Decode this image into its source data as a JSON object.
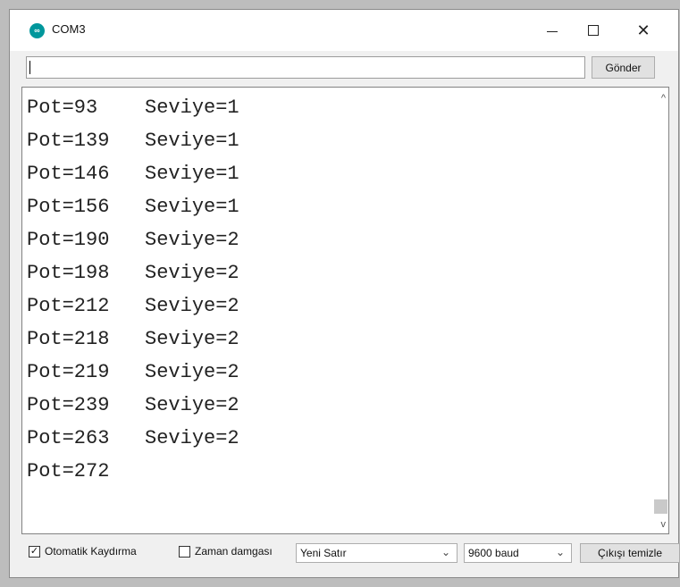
{
  "window": {
    "title": "COM3",
    "icon": "arduino-icon",
    "controls": {
      "minimize": "–",
      "maximize": "□",
      "close": "✕"
    }
  },
  "input_bar": {
    "value": "",
    "send_label": "Gönder"
  },
  "output": {
    "lines": [
      "Pot=93    Seviye=1",
      "Pot=139   Seviye=1",
      "Pot=146   Seviye=1",
      "Pot=156   Seviye=1",
      "Pot=190   Seviye=2",
      "Pot=198   Seviye=2",
      "Pot=212   Seviye=2",
      "Pot=218   Seviye=2",
      "Pot=219   Seviye=2",
      "Pot=239   Seviye=2",
      "Pot=263   Seviye=2",
      "Pot=272"
    ]
  },
  "bottom": {
    "autoscroll": {
      "label": "Otomatik Kaydırma",
      "checked": true,
      "mark": "✓"
    },
    "timestamp": {
      "label": "Zaman damgası",
      "checked": false,
      "mark": ""
    },
    "line_ending": {
      "value": "Yeni Satır"
    },
    "baud": {
      "value": "9600 baud"
    },
    "clear_label": "Çıkışı temizle"
  },
  "colors": {
    "accent": "#00979c",
    "window_bg": "#f0f0f0"
  }
}
